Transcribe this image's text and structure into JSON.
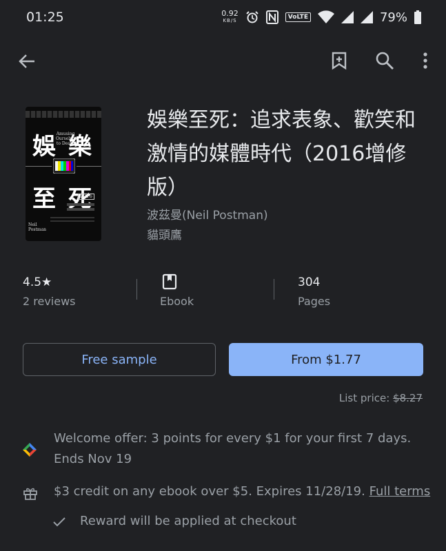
{
  "status_bar": {
    "time": "01:25",
    "net_speed": "0.92",
    "net_unit": "KB/S",
    "volte": "VoLTE",
    "battery": "79%",
    "icons": [
      "alarm-icon",
      "nfc-icon",
      "wifi-icon",
      "signal-icon",
      "signal-icon",
      "battery-icon"
    ]
  },
  "app_bar": {
    "icons": [
      "back-arrow-icon",
      "bookmark-add-icon",
      "search-icon",
      "more-vert-icon"
    ]
  },
  "book": {
    "title": "娛樂至死：追求表象、歡笑和激情的媒體時代（2016增修版）",
    "author": "波茲曼(Neil Postman)",
    "publisher": "貓頭鷹",
    "cover": {
      "big_chars": [
        "娛",
        "樂",
        "至",
        "死"
      ],
      "english_title": "Amusing Ourselves to Death",
      "edition": "2016",
      "author_en": "Neil Postman"
    }
  },
  "stats": {
    "rating": "4.5",
    "star": "★",
    "reviews": "2 reviews",
    "format": "Ebook",
    "pages": "304",
    "pages_label": "Pages"
  },
  "actions": {
    "sample_label": "Free sample",
    "buy_label": "From $1.77",
    "list_price_label": "List price: ",
    "list_price_value": "$8.27"
  },
  "offer": {
    "welcome": "Welcome offer: 3 points for every $1 for your first 7 days. Ends Nov 19",
    "credit": "$3 credit on any ebook over $5. Expires 11/28/19.",
    "credit_link": "Full terms",
    "reward": "Reward will be applied at checkout"
  },
  "colors": {
    "background": "#202124",
    "accent": "#8ab4f8",
    "text_primary": "#e8eaed",
    "text_secondary": "#9aa0a6"
  }
}
